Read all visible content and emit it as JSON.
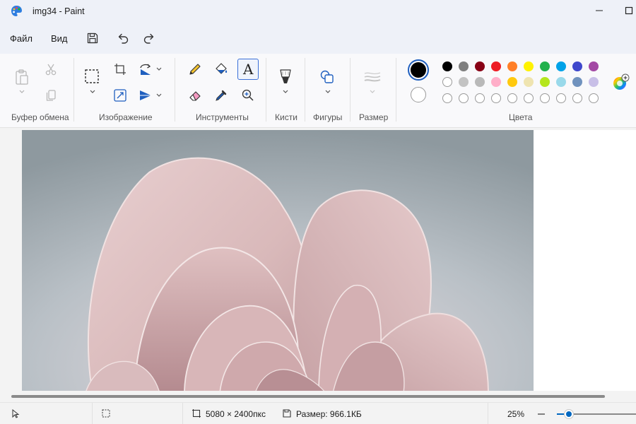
{
  "window": {
    "title": "img34 - Paint"
  },
  "menu": {
    "file": "Файл",
    "view": "Вид"
  },
  "ribbon": {
    "groups": {
      "clipboard": "Буфер обмена",
      "image": "Изображение",
      "tools": "Инструменты",
      "brushes": "Кисти",
      "shapes": "Фигуры",
      "size": "Размер",
      "colors": "Цвета"
    },
    "text_tool_glyph": "A",
    "palette": {
      "row1": [
        "#000000",
        "#7f7f7f",
        "#880015",
        "#ed1c24",
        "#ff7f27",
        "#fff200",
        "#22b14c",
        "#00a2e8",
        "#3f48cc",
        "#a349a4"
      ],
      "row2": [
        "#ffffff",
        "#c3c3c3",
        "#b9b9b9",
        "#ffaec9",
        "#ffc90e",
        "#efe4b0",
        "#b5e61d",
        "#99d9ea",
        "#7092be",
        "#c8bfe7"
      ],
      "row3_empty_count": 10
    },
    "primary_color": "#000000",
    "secondary_color": "#ffffff"
  },
  "status": {
    "image_size": "5080 × 2400пкс",
    "file_size": "Размер: 966.1КБ",
    "zoom": "25%",
    "zoom_level": 0.15
  }
}
